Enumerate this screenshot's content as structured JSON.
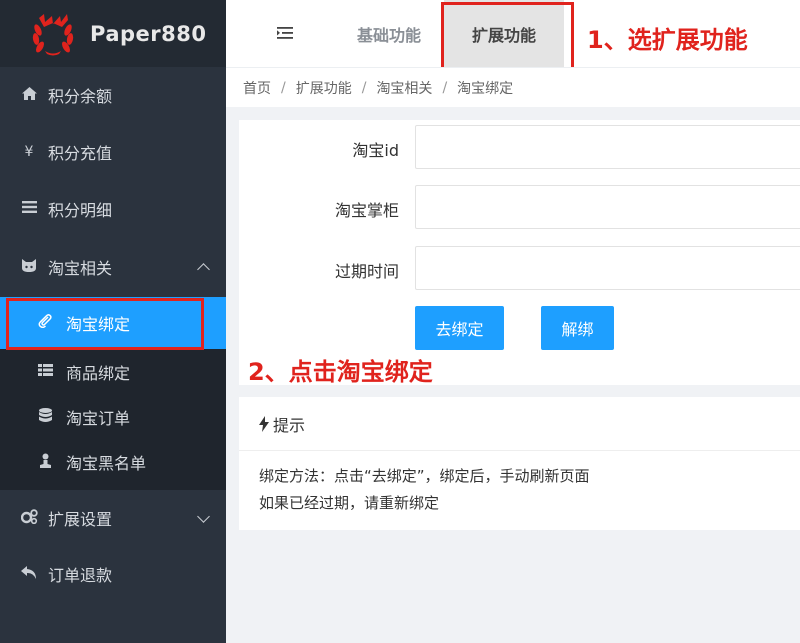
{
  "app": {
    "name": "Paper880"
  },
  "sidebar": {
    "items": [
      {
        "label": "积分余额",
        "icon": "home-icon"
      },
      {
        "label": "积分充值",
        "icon": "yen-icon"
      },
      {
        "label": "积分明细",
        "icon": "list-icon"
      },
      {
        "label": "淘宝相关",
        "icon": "github-cat-icon",
        "expanded": true
      },
      {
        "label": "扩展设置",
        "icon": "gears-icon",
        "expanded": false
      },
      {
        "label": "订单退款",
        "icon": "reply-icon"
      }
    ],
    "submenu": [
      {
        "label": "淘宝绑定",
        "icon": "paperclip-icon",
        "active": true
      },
      {
        "label": "商品绑定",
        "icon": "grid-list-icon"
      },
      {
        "label": "淘宝订单",
        "icon": "database-icon"
      },
      {
        "label": "淘宝黑名单",
        "icon": "user-icon"
      }
    ]
  },
  "header": {
    "tabs": [
      {
        "label": "基础功能"
      },
      {
        "label": "扩展功能",
        "active": true
      }
    ]
  },
  "annotations": {
    "step1": "1、选扩展功能",
    "step2": "2、点击淘宝绑定",
    "color": "#e0231d"
  },
  "breadcrumb": [
    "首页",
    "扩展功能",
    "淘宝相关",
    "淘宝绑定"
  ],
  "form": {
    "fields": [
      {
        "label": "淘宝id",
        "value": ""
      },
      {
        "label": "淘宝掌柜",
        "value": ""
      },
      {
        "label": "过期时间",
        "value": ""
      }
    ],
    "bind_button": "去绑定",
    "unbind_button": "解绑"
  },
  "tip": {
    "title": "提示",
    "lines": [
      "绑定方法：点击“去绑定”，绑定后，手动刷新页面",
      "如果已经过期，请重新绑定"
    ]
  },
  "colors": {
    "accent": "#1e9fff",
    "sidebar": "#2b333e",
    "sidebar_logo": "#232a33",
    "submenu": "#1f252d"
  }
}
